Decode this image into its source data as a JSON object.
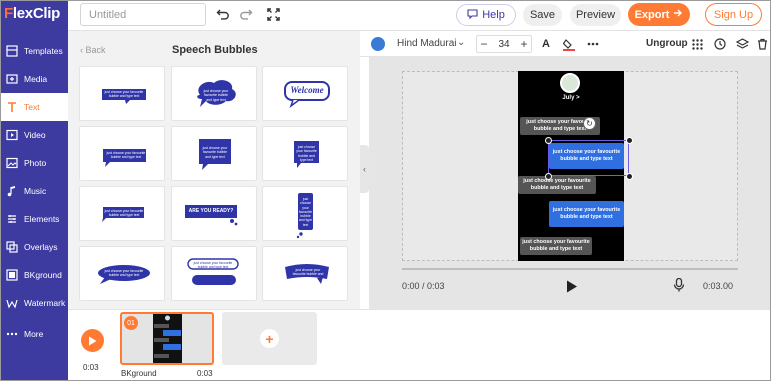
{
  "app": {
    "logo_text": "lexClip",
    "logo_f": "F"
  },
  "header": {
    "title_placeholder": "Untitled",
    "help_label": "Help",
    "save_label": "Save",
    "preview_label": "Preview",
    "export_label": "Export",
    "signup_label": "Sign Up"
  },
  "sidebar": {
    "items": [
      {
        "label": "Templates",
        "icon": "templates-icon"
      },
      {
        "label": "Media",
        "icon": "media-icon"
      },
      {
        "label": "Text",
        "icon": "text-icon"
      },
      {
        "label": "Video",
        "icon": "video-icon"
      },
      {
        "label": "Photo",
        "icon": "photo-icon"
      },
      {
        "label": "Music",
        "icon": "music-icon"
      },
      {
        "label": "Elements",
        "icon": "elements-icon"
      },
      {
        "label": "Overlays",
        "icon": "overlays-icon"
      },
      {
        "label": "BKground",
        "icon": "background-icon"
      },
      {
        "label": "Watermark",
        "icon": "watermark-icon"
      },
      {
        "label": "More",
        "icon": "more-icon"
      }
    ],
    "active": "Text"
  },
  "panel": {
    "back_label": "Back",
    "title": "Speech Bubbles",
    "tiles": [
      {
        "text": "just choose your favourite bubble and type text"
      },
      {
        "text": "just choose your favourite bubble and type text"
      },
      {
        "text": "Welcome"
      },
      {
        "text": "just choose your favourite bubble and type text"
      },
      {
        "text": "just choose your favourite bubble and type text"
      },
      {
        "text": "just choose your favourite bubble and type text"
      },
      {
        "text": "just choose your favourite bubble and type text"
      },
      {
        "text": "ARE YOU READY?"
      },
      {
        "text": "just choose your favourite bubble and type text"
      },
      {
        "text": "just choose your favourite bubble and type text"
      },
      {
        "text": "just choose your favourite bubble and type text"
      },
      {
        "text": "just choose your favourite bubble and type text"
      }
    ]
  },
  "edit_toolbar": {
    "color": "#3a7bd5",
    "font_name": "Hind Madurai",
    "font_size": "34",
    "ungroup_label": "Ungroup"
  },
  "canvas": {
    "date_label": "July >",
    "bubbles": [
      {
        "text": "just choose your favourite bubble and type text",
        "style": "gray"
      },
      {
        "text": "just choose your favourite bubble and type text",
        "style": "blue"
      },
      {
        "text": "just choose your favourite bubble and type text",
        "style": "gray"
      },
      {
        "text": "just choose your favourite bubble and type text",
        "style": "blue"
      },
      {
        "text": "just choose your favourite bubble and type text",
        "style": "gray"
      }
    ],
    "current_time": "0:00 / 0:03",
    "total_time": "0:03.00"
  },
  "timeline": {
    "play_time": "0:03",
    "clip_badge": "01",
    "clip_label": "BKground",
    "clip_duration": "0:03"
  },
  "colors": {
    "brand": "#3d3aa0",
    "accent": "#ff7b33",
    "bubble_blue": "#2f6fe0"
  }
}
